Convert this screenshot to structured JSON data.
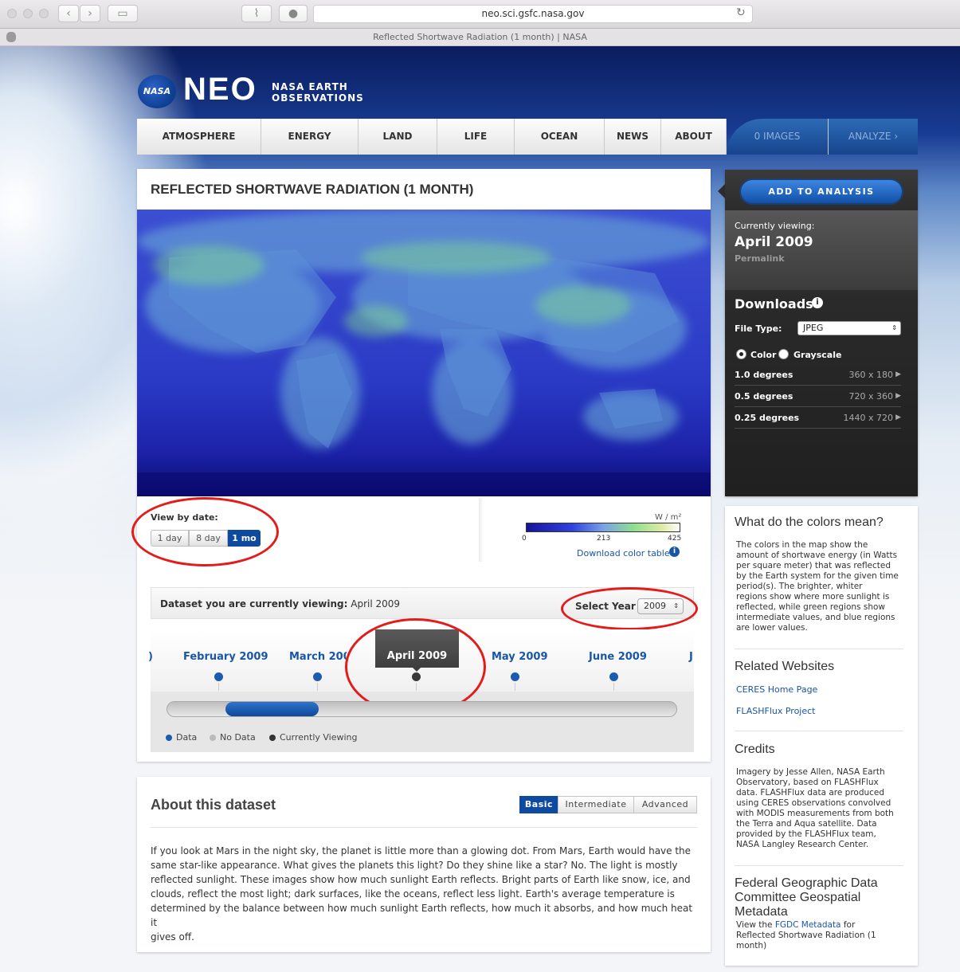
{
  "browser": {
    "url": "neo.sci.gsfc.nasa.gov",
    "tab_title": "Reflected Shortwave Radiation (1 month) | NASA"
  },
  "header": {
    "nasa_logo": "NASA",
    "logo": "NEO",
    "logo_sub_1": "NASA EARTH",
    "logo_sub_2": "OBSERVATIONS"
  },
  "nav": {
    "items": [
      "ATMOSPHERE",
      "ENERGY",
      "LAND",
      "LIFE",
      "OCEAN",
      "NEWS",
      "ABOUT"
    ],
    "images": "0 IMAGES",
    "analyze": "ANALYZE"
  },
  "dataset": {
    "title": "REFLECTED SHORTWAVE RADIATION (1 MONTH)",
    "view_by_label": "View by date:",
    "view_options": [
      "1 day",
      "8 day",
      "1 mo"
    ],
    "selected_view": "1 mo",
    "colorbar": {
      "unit": "W / m²",
      "min": "0",
      "mid": "213",
      "max": "425",
      "download": "Download color table"
    },
    "viewing_label": "Dataset you are currently viewing:",
    "viewing_value": "April 2009",
    "select_year_label": "Select Year",
    "year": "2009"
  },
  "timeline": {
    "months": [
      "February 2009",
      "March 2009",
      "April 2009",
      "May 2009",
      "June 2009"
    ],
    "current": "April 2009",
    "progress": 0.14,
    "legend": {
      "data": "Data",
      "no_data": "No Data",
      "current": "Currently Viewing"
    }
  },
  "about": {
    "heading": "About this dataset",
    "tabs": [
      "Basic",
      "Intermediate",
      "Advanced"
    ],
    "active_tab": "Basic",
    "lines": [
      "If you look at Mars in the night sky, the planet is little more than a glowing dot. From Mars, Earth would have the",
      "same star-like appearance. What gives the planets this light? Do they shine like a star? No. The light is mostly",
      "reflected sunlight. These images show how much sunlight Earth reflects. Bright parts of Earth like snow, ice, and",
      "clouds, reflect the most light; dark surfaces, like the oceans, reflect less light. Earth's average temperature is",
      "determined by the balance between how much sunlight Earth reflects, how much it absorbs, and how much heat it",
      "gives off."
    ]
  },
  "sidebar": {
    "add_button": "ADD TO ANALYSIS",
    "currently_viewing": "Currently viewing:",
    "date": "April 2009",
    "permalink": "Permalink",
    "downloads": "Downloads",
    "file_type_label": "File Type:",
    "file_type": "JPEG",
    "color": "Color",
    "grayscale": "Grayscale",
    "resolutions": [
      {
        "label": "1.0 degrees",
        "size": "360 x 180"
      },
      {
        "label": "0.5 degrees",
        "size": "720 x 360"
      },
      {
        "label": "0.25 degrees",
        "size": "1440 x 720"
      }
    ],
    "colors_heading": "What do the colors mean?",
    "colors_lines": [
      "The colors in the map show the",
      "amount of shortwave energy (in Watts",
      "per square meter) that was reflected",
      "by the Earth system for the given time",
      "period(s). The brighter, whiter",
      "regions show where more sunlight is",
      "reflected, while green regions show",
      "intermediate values, and blue regions",
      "are lower values."
    ],
    "related_heading": "Related Websites",
    "related_links": [
      "CERES Home Page",
      "FLASHFlux Project"
    ],
    "credits_heading": "Credits",
    "credits_lines": [
      "Imagery by Jesse Allen, NASA Earth",
      "Observatory, based on FLASHFlux",
      "data. FLASHFlux data are produced",
      "using CERES observations convolved",
      "with MODIS measurements from both",
      "the Terra and Aqua satellite. Data",
      "provided by the FLASHFlux team,",
      "NASA Langley Research Center."
    ],
    "fgdc_heading_1": "Federal Geographic Data",
    "fgdc_heading_2": "Committee Geospatial",
    "fgdc_heading_3": "Metadata",
    "fgdc_pre": "View the",
    "fgdc_link": "FGDC Metadata",
    "fgdc_post": "for",
    "fgdc_line2": "Reflected Shortwave Radiation (1",
    "fgdc_line3": "month)"
  }
}
